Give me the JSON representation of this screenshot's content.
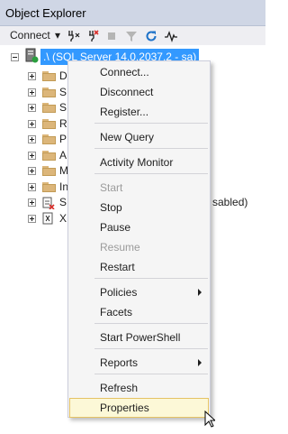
{
  "window": {
    "title": "Object Explorer"
  },
  "toolbar": {
    "connect_label": "Connect",
    "connect_chevron": "▾"
  },
  "tree": {
    "server_label": ".\\ (SQL Server 14.0.2037.2 - sa)",
    "children": [
      {
        "label": "D",
        "icon": "folder-icon"
      },
      {
        "label": "S",
        "icon": "folder-icon"
      },
      {
        "label": "S",
        "icon": "folder-icon"
      },
      {
        "label": "R",
        "icon": "folder-icon"
      },
      {
        "label": "P",
        "icon": "folder-icon"
      },
      {
        "label": "A",
        "icon": "folder-icon"
      },
      {
        "label": "M",
        "icon": "folder-icon"
      },
      {
        "label": "In",
        "icon": "folder-icon"
      },
      {
        "label": "S",
        "icon": "agent-icon",
        "suffix": "sabled)"
      },
      {
        "label": "X",
        "icon": "xevent-icon"
      }
    ]
  },
  "context_menu": {
    "items": [
      {
        "label": "Connect...",
        "enabled": true
      },
      {
        "label": "Disconnect",
        "enabled": true
      },
      {
        "label": "Register...",
        "enabled": true
      },
      {
        "label": "New Query",
        "enabled": true
      },
      {
        "label": "Activity Monitor",
        "enabled": true
      },
      {
        "label": "Start",
        "enabled": false
      },
      {
        "label": "Stop",
        "enabled": true
      },
      {
        "label": "Pause",
        "enabled": true
      },
      {
        "label": "Resume",
        "enabled": false
      },
      {
        "label": "Restart",
        "enabled": true
      },
      {
        "label": "Policies",
        "enabled": true,
        "submenu": true
      },
      {
        "label": "Facets",
        "enabled": true
      },
      {
        "label": "Start PowerShell",
        "enabled": true
      },
      {
        "label": "Reports",
        "enabled": true,
        "submenu": true
      },
      {
        "label": "Refresh",
        "enabled": true
      },
      {
        "label": "Properties",
        "enabled": true,
        "hovered": true
      }
    ]
  },
  "colors": {
    "selection": "#3399ff",
    "hover_bg": "#fcf8d7",
    "hover_border": "#e5c365",
    "disabled_text": "#9b9b9b"
  }
}
